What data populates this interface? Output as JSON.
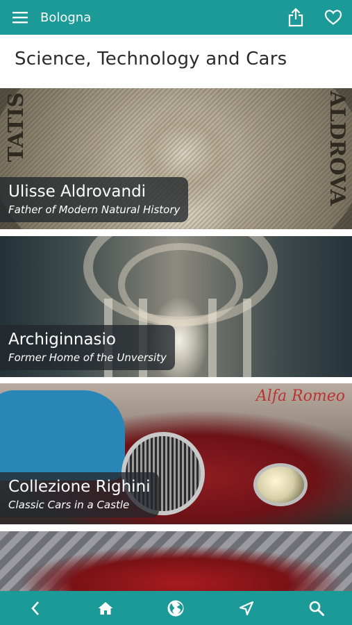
{
  "header": {
    "title": "Bologna",
    "menu_icon": "hamburger-icon",
    "share_icon": "share-icon",
    "favorite_icon": "heart-icon"
  },
  "page": {
    "title": "Science, Technology and Cars"
  },
  "cards": [
    {
      "name": "Ulisse Aldrovandi",
      "subtitle": "Father of Modern Natural History"
    },
    {
      "name": "Archiginnasio",
      "subtitle": "Former Home of the Unversity"
    },
    {
      "name": "Collezione Righini",
      "subtitle": "Classic Cars in a Castle"
    }
  ],
  "photo_text": {
    "card0_left": "TATIS",
    "card0_right": "ALDROVA",
    "card2_sign": "Alfa Romeo"
  },
  "bottom_nav": [
    {
      "icon": "back-icon"
    },
    {
      "icon": "home-icon"
    },
    {
      "icon": "globe-icon"
    },
    {
      "icon": "navigate-icon"
    },
    {
      "icon": "search-icon"
    }
  ],
  "colors": {
    "bar": "#1c9a98",
    "caption_bg": "#23282d"
  }
}
